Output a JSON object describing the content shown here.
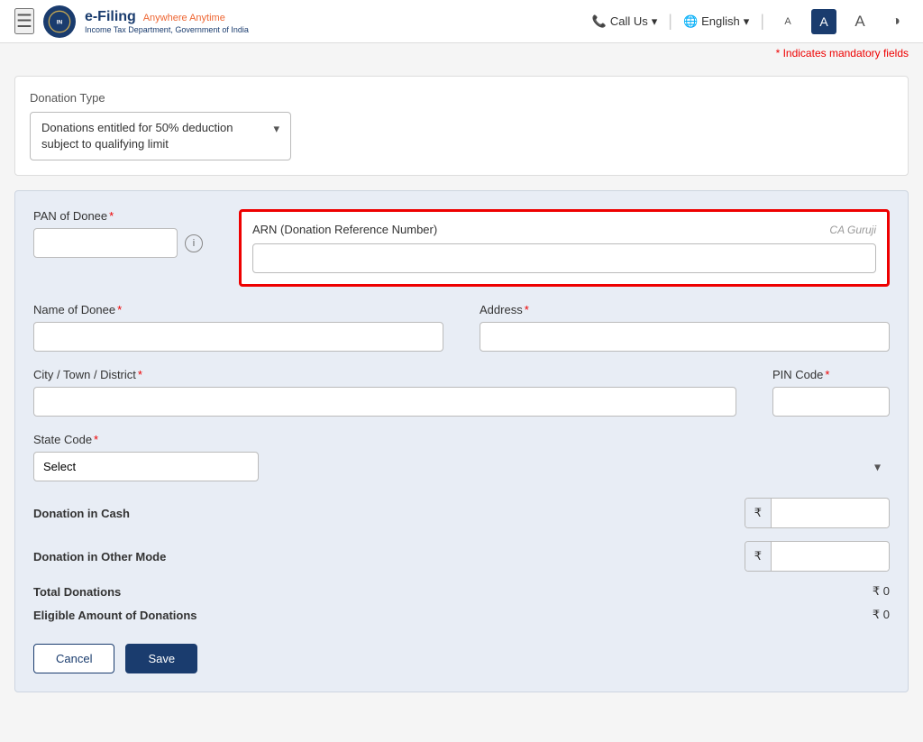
{
  "header": {
    "hamburger_label": "☰",
    "logo_efiling": "e-Filing",
    "logo_tagline": "Anywhere Anytime",
    "logo_subtitle": "Income Tax Department, Government of India",
    "call_us_label": "Call Us",
    "language_label": "English",
    "font_small_label": "A",
    "font_medium_label": "A",
    "font_large_label": "A",
    "contrast_label": "◑"
  },
  "mandatory_note": "* Indicates mandatory fields",
  "donation_type": {
    "label": "Donation Type",
    "value": "Donations entitled for 50% deduction subject to qualifying limit"
  },
  "form": {
    "pan_label": "PAN of Donee",
    "pan_required": "*",
    "pan_placeholder": "",
    "arn_label": "ARN (Donation Reference Number)",
    "arn_watermark": "CA Guruji",
    "arn_placeholder": "",
    "name_label": "Name of Donee",
    "name_required": "*",
    "name_placeholder": "",
    "address_label": "Address",
    "address_required": "*",
    "address_placeholder": "",
    "city_label": "City / Town / District",
    "city_required": "*",
    "city_placeholder": "",
    "pin_label": "PIN Code",
    "pin_required": "*",
    "pin_placeholder": "",
    "state_label": "State Code",
    "state_required": "*",
    "state_placeholder": "Select",
    "donation_cash_label": "Donation in Cash",
    "donation_other_label": "Donation in Other Mode",
    "total_label": "Total Donations",
    "total_value": "₹ 0",
    "eligible_label": "Eligible Amount of Donations",
    "eligible_value": "₹ 0",
    "currency_symbol": "₹",
    "cancel_label": "Cancel",
    "save_label": "Save"
  }
}
